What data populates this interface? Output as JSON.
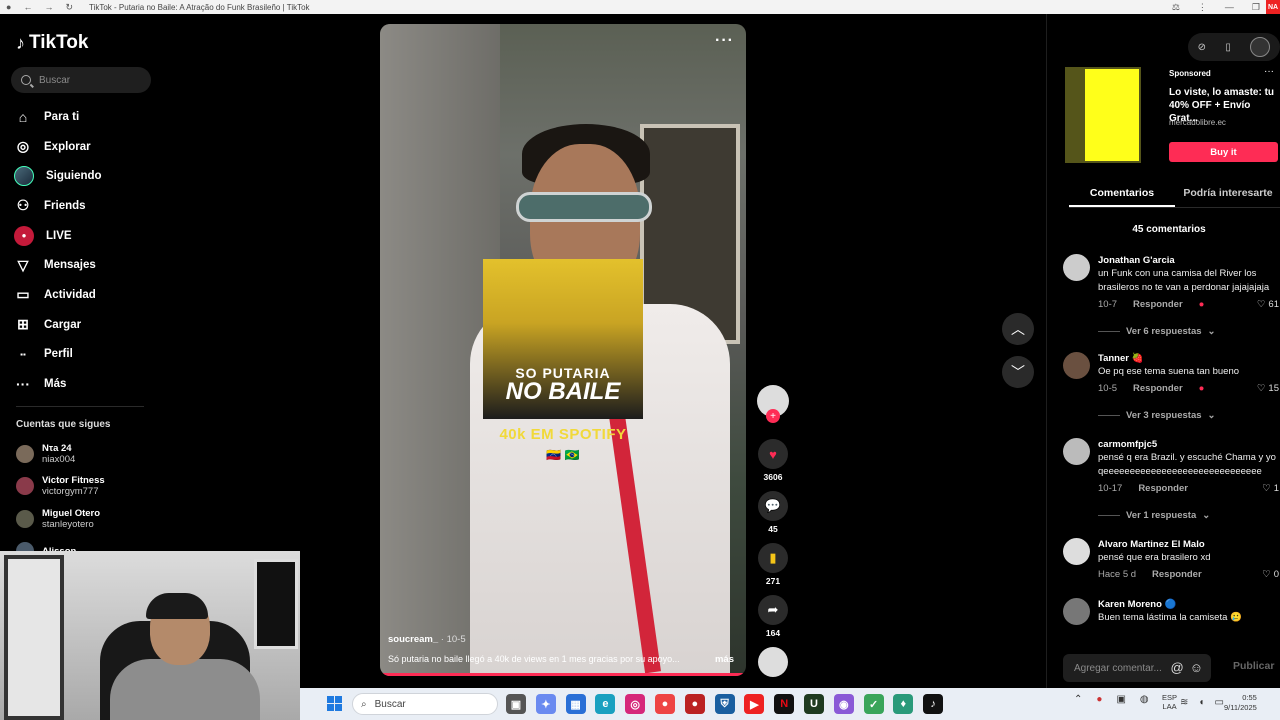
{
  "browser": {
    "tab_title": "TikTok - Putaria no Baile: A Atração do Funk Brasileño | TikTok",
    "badge": "NA"
  },
  "sidebar": {
    "logo": "TikTok",
    "search_placeholder": "Buscar",
    "nav": [
      {
        "icon": "home-icon",
        "label": "Para ti"
      },
      {
        "icon": "compass-icon",
        "label": "Explorar"
      },
      {
        "icon": "avatar-icon",
        "label": "Siguiendo"
      },
      {
        "icon": "friends-icon",
        "label": "Friends"
      },
      {
        "icon": "live-icon",
        "label": "LIVE"
      },
      {
        "icon": "send-icon",
        "label": "Mensajes"
      },
      {
        "icon": "inbox-icon",
        "label": "Actividad"
      },
      {
        "icon": "upload-icon",
        "label": "Cargar"
      },
      {
        "icon": "profile-icon",
        "label": "Perfil"
      },
      {
        "icon": "more-icon",
        "label": "Más"
      }
    ],
    "following_title": "Cuentas que sigues",
    "following": [
      {
        "name": "Nτa 24",
        "user": "niax004"
      },
      {
        "name": "Victor Fitness",
        "user": "victorgym777"
      },
      {
        "name": "Miguel Otero",
        "user": "stanleyotero"
      },
      {
        "name": "Alisson",
        "user": ""
      }
    ]
  },
  "video": {
    "cover_line1": "SO PUTARIA",
    "cover_line2": "NO BAILE",
    "overlay_text": "40k EM SPOTIFY",
    "flags": "🇻🇪 🇧🇷",
    "author": "soucream_",
    "time": " · 10-5",
    "caption": "Só putaria no baile llegó a 40k de views en 1 mes gracias por su apoyo...",
    "more": "más",
    "menu": "···"
  },
  "actions": {
    "likes": "3606",
    "comments": "45",
    "saves": "271",
    "shares": "164"
  },
  "ad": {
    "sponsored": "Sponsored",
    "title": "Lo viste, lo amaste: tu 40% OFF + Envío Grat...",
    "domain": "mercadolibre.ec",
    "cta": "Buy it"
  },
  "tabs": [
    {
      "label": "Comentarios",
      "active": true
    },
    {
      "label": "Podría interesarte",
      "active": false
    }
  ],
  "comments_count": "45 comentarios",
  "comments": [
    {
      "name": "Jonathan G'arcia",
      "text": "un Funk con una camisa del River los brasileros no te van a perdonar jajajajaja",
      "date": "10-7",
      "reply": "Responder",
      "likes": "61",
      "replies": "Ver 6 respuestas"
    },
    {
      "name": "Tanner 🍓",
      "text": "Oe pq ese tema suena tan bueno",
      "date": "10-5",
      "reply": "Responder",
      "likes": "15",
      "replies": "Ver 3 respuestas"
    },
    {
      "name": "carmomfpjc5",
      "text": "pensé q era Brazil. y escuché Chama y yo qeeeeeeeeeeeeeeeeeeeeeeeeeeeeee",
      "date": "10-17",
      "reply": "Responder",
      "likes": "1",
      "replies": "Ver 1 respuesta"
    },
    {
      "name": "Alvaro Martinez El Malo",
      "text": "pensé que era brasilero xd",
      "date": "Hace 5 d",
      "reply": "Responder",
      "likes": "0",
      "replies": ""
    },
    {
      "name": "Karen Moreno 🔵",
      "text": "Buen tema lástima la camiseta 🥲",
      "date": "",
      "reply": "",
      "likes": "",
      "replies": ""
    }
  ],
  "composer": {
    "placeholder": "Agregar comentar...",
    "publish": "Publicar"
  },
  "taskbar": {
    "search": "Buscar",
    "lang1": "ESP",
    "lang2": "LAA",
    "time": "0:55",
    "date": "9/11/2025"
  }
}
